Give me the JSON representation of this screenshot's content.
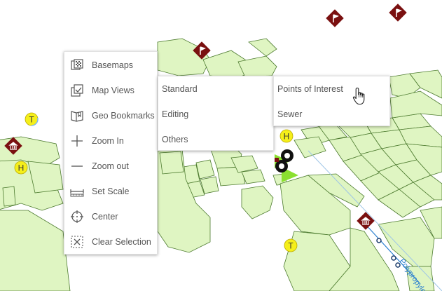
{
  "context_menu": {
    "items": [
      {
        "label": "Basemaps",
        "icon": "basemaps-icon"
      },
      {
        "label": "Map Views",
        "icon": "map-views-icon"
      },
      {
        "label": "Geo Bookmarks",
        "icon": "bookmark-icon"
      },
      {
        "label": "Zoom In",
        "icon": "plus-icon"
      },
      {
        "label": "Zoom out",
        "icon": "minus-icon"
      },
      {
        "label": "Set Scale",
        "icon": "ruler-icon"
      },
      {
        "label": "Center",
        "icon": "crosshair-icon"
      },
      {
        "label": "Clear Selection",
        "icon": "clear-selection-icon"
      }
    ]
  },
  "map_views_submenu": {
    "items": [
      "Standard",
      "Editing",
      "Others"
    ]
  },
  "standard_submenu": {
    "items": [
      "Points of Interest",
      "Sewer"
    ],
    "hovered": "Points of Interest"
  },
  "map": {
    "markers": {
      "T": "T",
      "H": "H"
    },
    "street_label": "Polypropylen",
    "colors": {
      "parcel_fill": "#dff5c2",
      "parcel_stroke": "#4c7a2e",
      "poi_marker": "#7a1010",
      "label_marker": "#f5ef1a",
      "pipe": "#2a7fd0"
    }
  }
}
